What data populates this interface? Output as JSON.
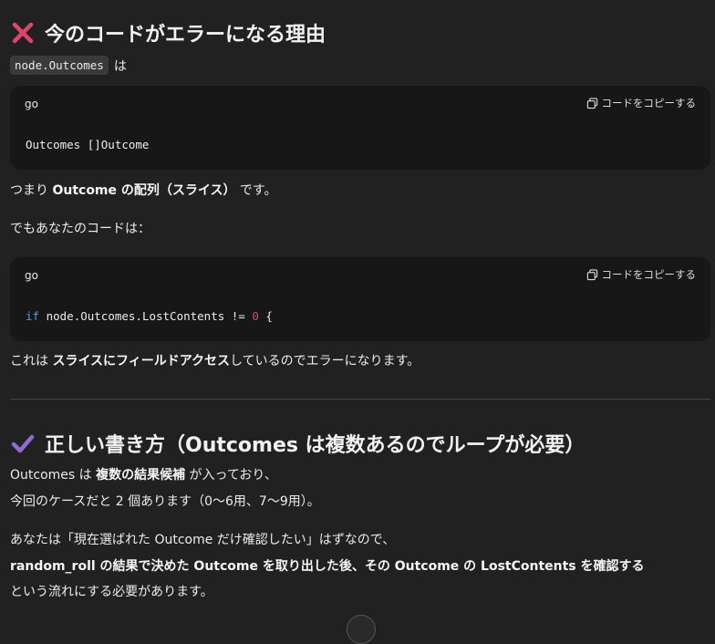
{
  "section1": {
    "heading": "今のコードがエラーになる理由",
    "inline_code": "node.Outcomes",
    "inline_after": "は"
  },
  "codeblock1": {
    "lang": "go",
    "copy_label": "コードをコピーする",
    "code": "Outcomes []Outcome"
  },
  "para1": {
    "pre": "つまり ",
    "bold": "Outcome の配列（スライス）",
    "post": " です。"
  },
  "para2": "でもあなたのコードは：",
  "codeblock2": {
    "lang": "go",
    "copy_label": "コードをコピーする",
    "kw": "if",
    "mid": " node.Outcomes.LostContents != ",
    "num": "0",
    "end": " {"
  },
  "para3": {
    "pre": "これは ",
    "bold": "スライスにフィールドアクセス",
    "post": "しているのでエラーになります。"
  },
  "section2": {
    "heading": "正しい書き方（Outcomes は複数あるのでループが必要）"
  },
  "para4": {
    "pre": "Outcomes は ",
    "bold": "複数の結果候補",
    "post": " が入っており、"
  },
  "para5": "今回のケースだと 2 個あります（0〜6用、7〜9用）。",
  "para6": "あなたは「現在選ばれた Outcome だけ確認したい」はずなので、",
  "para7": "random_roll の結果で決めた Outcome を取り出した後、その Outcome の LostContents を確認する",
  "para8": "という流れにする必要があります。",
  "colors": {
    "background": "#212121",
    "codeblock_bg": "#171717",
    "cross_icon": "#e0446a",
    "check_icon": "#8f6bd6",
    "keyword": "#569cd6",
    "number": "#e0446a"
  }
}
